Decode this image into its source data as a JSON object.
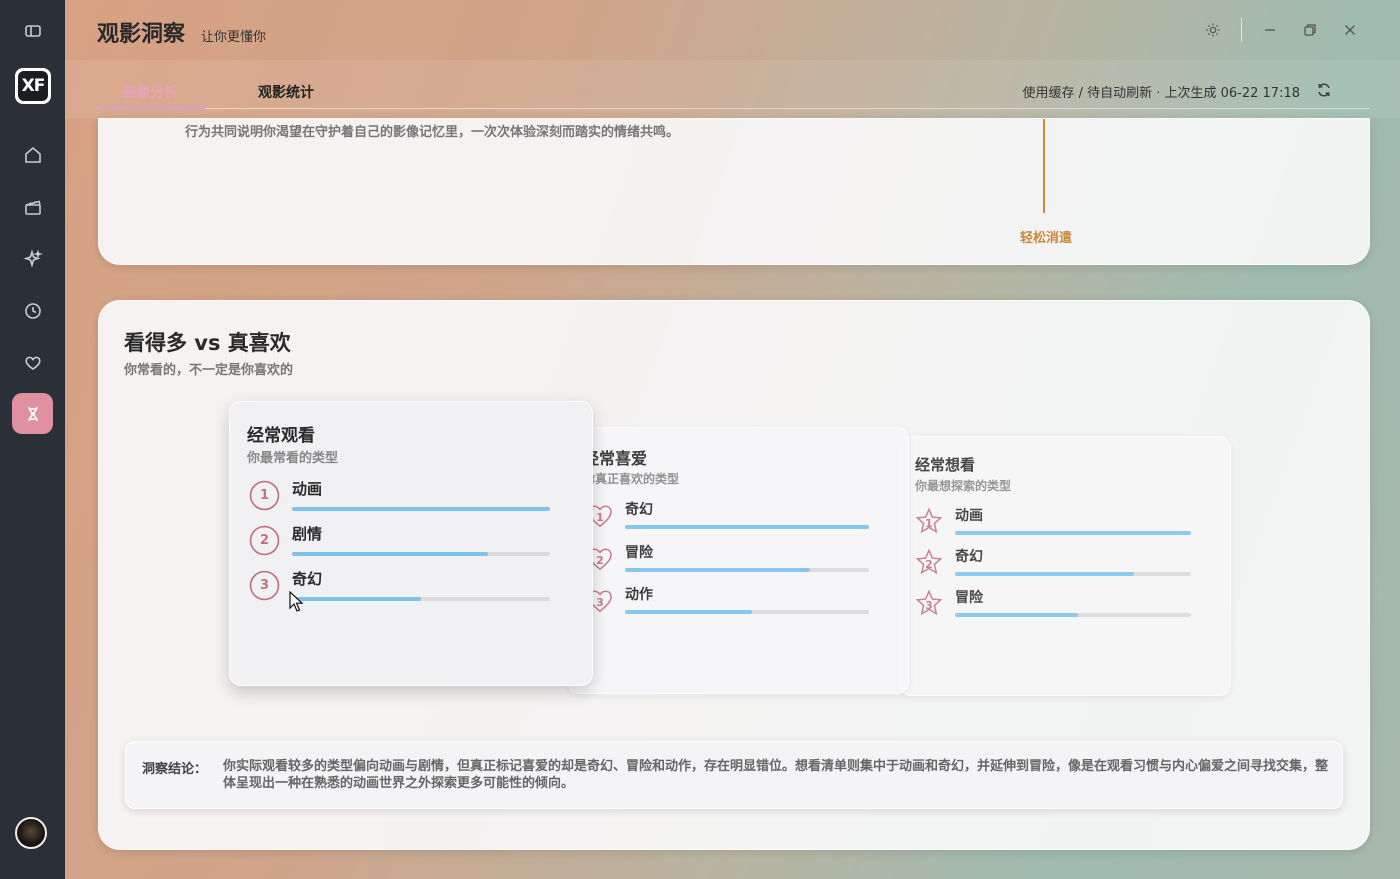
{
  "app": {
    "title": "观影洞察",
    "subtitle": "让你更懂你"
  },
  "sidebar": {
    "items": [
      {
        "icon": "sidebar-toggle-icon"
      },
      {
        "icon": "home-icon"
      },
      {
        "icon": "clapperboard-icon"
      },
      {
        "icon": "sparkles-icon"
      },
      {
        "icon": "history-clock-icon"
      },
      {
        "icon": "heart-icon"
      },
      {
        "icon": "dna-icon",
        "active": true
      }
    ],
    "logo_text": "XF"
  },
  "tabs": [
    {
      "label": "画像分析",
      "active": true
    },
    {
      "label": "观影统计",
      "active": false
    }
  ],
  "status": {
    "text": "使用缓存 / 待自动刷新 · 上次生成 06-22 17:18"
  },
  "top_panel": {
    "text": "行为共同说明你渴望在守护着自己的影像记忆里，一次次体验深刻而踏实的情绪共鸣。",
    "timeline_label": "轻松消遣"
  },
  "section": {
    "title": "看得多 vs 真喜欢",
    "subtitle": "你常看的，不一定是你喜欢的"
  },
  "cards": [
    {
      "title": "经常观看",
      "subtitle": "你最常看的类型",
      "icon_type": "circle",
      "items": [
        {
          "rank": "1",
          "label": "动画",
          "value": 1.0
        },
        {
          "rank": "2",
          "label": "剧情",
          "value": 0.76
        },
        {
          "rank": "3",
          "label": "奇幻",
          "value": 0.5
        }
      ]
    },
    {
      "title": "经常喜爱",
      "subtitle": "你真正喜欢的类型",
      "icon_type": "heart",
      "items": [
        {
          "rank": "1",
          "label": "奇幻",
          "value": 1.0
        },
        {
          "rank": "2",
          "label": "冒险",
          "value": 0.76
        },
        {
          "rank": "3",
          "label": "动作",
          "value": 0.52
        }
      ]
    },
    {
      "title": "经常想看",
      "subtitle": "你最想探索的类型",
      "icon_type": "star",
      "items": [
        {
          "rank": "1",
          "label": "动画",
          "value": 1.0
        },
        {
          "rank": "2",
          "label": "奇幻",
          "value": 0.76
        },
        {
          "rank": "3",
          "label": "冒险",
          "value": 0.52
        }
      ]
    }
  ],
  "conclusion": {
    "label": "洞察结论：",
    "text": "你实际观看较多的类型偏向动画与剧情，但真正标记喜爱的却是奇幻、冒险和动作，存在明显错位。想看清单则集中于动画和奇幻，并延伸到冒险，像是在观看习惯与内心偏爱之间寻找交集，整体呈现出一种在熟悉的动画世界之外探索更多可能性的倾向。"
  },
  "colors": {
    "accent_pink": "#e0909e",
    "bar_blue": "#7cc3ee",
    "timeline_orange": "#c98a3d"
  }
}
